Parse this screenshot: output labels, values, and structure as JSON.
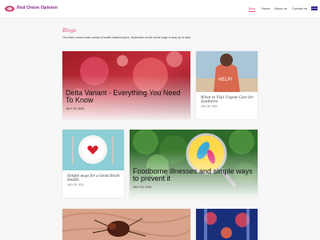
{
  "header": {
    "brand": "Red Onion Opinion",
    "nav": [
      "Blog",
      "Home",
      "About us",
      "Contact us"
    ]
  },
  "intro": {
    "title": "Blogs",
    "text": "Our team covers wide variety of health related topics. Subscribe on the home page to stay up to date"
  },
  "posts": [
    {
      "title": "Delta Variant - Everything You Need To Know",
      "date": "JULY 23, 2021"
    },
    {
      "title": "When to Visit Urgent Care for Sunburns",
      "date": "JULY 20, 2021"
    },
    {
      "title": "Simple ways for a Good Heart Health",
      "date": "JULY 20, 2021"
    },
    {
      "title": "Foodborne illnesses and simple ways to prevent it",
      "date": "JULY 20, 2021"
    }
  ],
  "colors": {
    "accent": "#e0457b",
    "brand": "#8a2a8d"
  }
}
